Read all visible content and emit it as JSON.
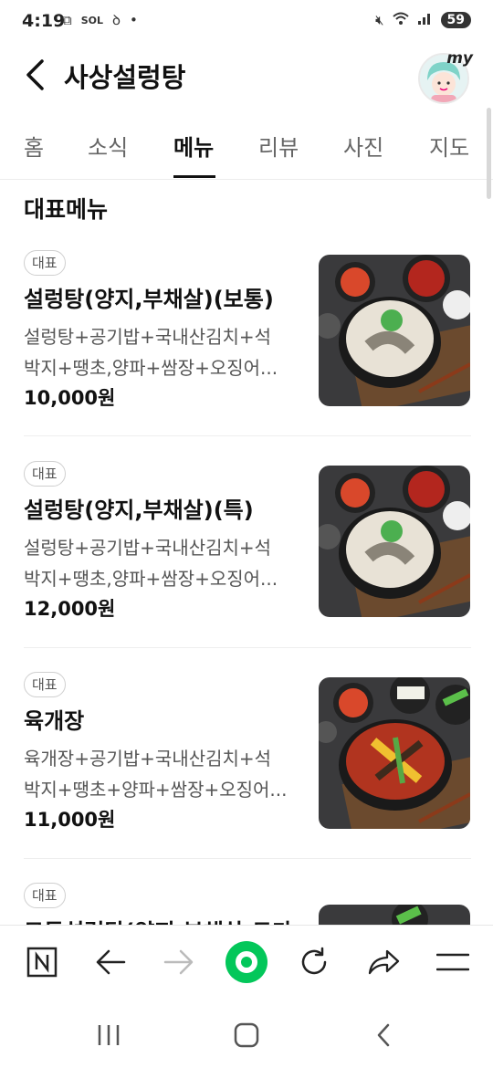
{
  "status_bar": {
    "time": "4:19",
    "battery": "59",
    "sol_label": "SOL"
  },
  "header": {
    "title": "사상설렁탕",
    "my_badge": "my"
  },
  "tabs": [
    {
      "label": "홈"
    },
    {
      "label": "소식"
    },
    {
      "label": "메뉴",
      "active": true
    },
    {
      "label": "리뷰"
    },
    {
      "label": "사진"
    },
    {
      "label": "지도"
    }
  ],
  "section": {
    "title": "대표메뉴"
  },
  "menu_items": [
    {
      "badge": "대표",
      "name": "설렁탕(양지,부채살)(보통)",
      "desc_line1": "설렁탕+공기밥+국내산김치+석",
      "desc_line2": "박지+땡초,양파+쌈장+오징어...",
      "price": "10,000원",
      "image": "seolleongtang-photo"
    },
    {
      "badge": "대표",
      "name": "설렁탕(양지,부채살)(특)",
      "desc_line1": "설렁탕+공기밥+국내산김치+석",
      "desc_line2": "박지+땡초,양파+쌈장+오징어...",
      "price": "12,000원",
      "image": "seolleongtang-photo"
    },
    {
      "badge": "대표",
      "name": "육개장",
      "desc_line1": "육개장+공기밥+국내산김치+석",
      "desc_line2": "박지+땡초+양파+쌈장+오징어...",
      "price": "11,000원",
      "image": "yukgaejang-photo"
    },
    {
      "badge": "대표",
      "name": "모둠설렁탕(양지,부채살,도가",
      "image": "seolleongtang-photo"
    }
  ],
  "colors": {
    "accent_green": "#03c75a",
    "text": "#111111",
    "muted": "#555555"
  }
}
